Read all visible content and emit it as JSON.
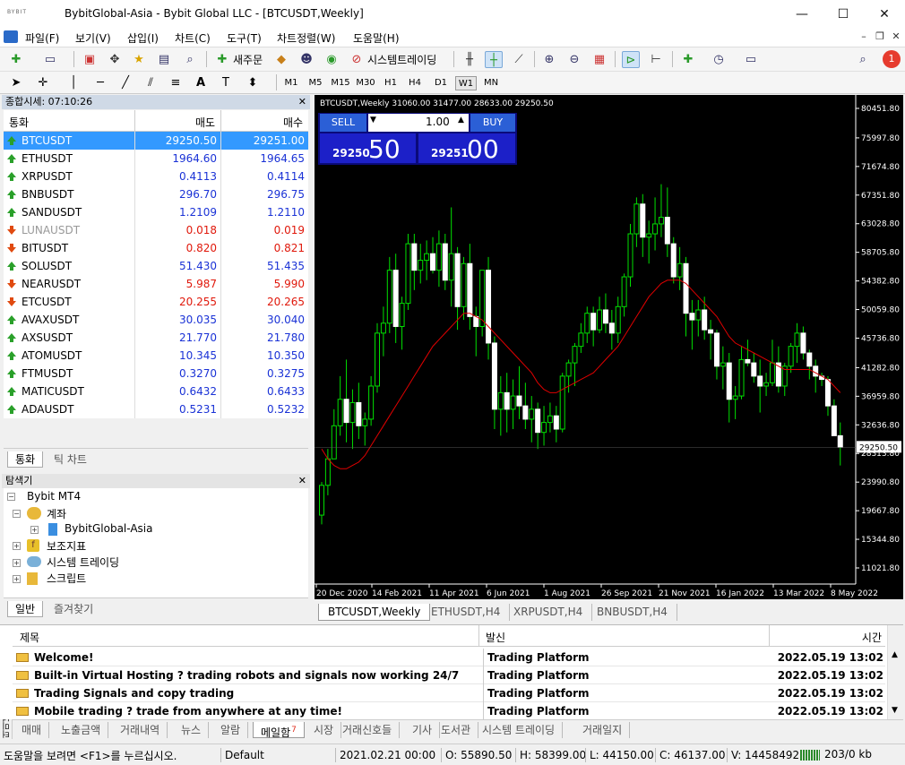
{
  "window": {
    "logo": "BYBIT",
    "title": "BybitGlobal-Asia - Bybit Global LLC - [BTCUSDT,Weekly]"
  },
  "menu": [
    "파일(F)",
    "보기(V)",
    "삽입(I)",
    "차트(C)",
    "도구(T)",
    "차트정렬(W)",
    "도움말(H)"
  ],
  "toolbar": {
    "new_order": "새주문",
    "algo_trading": "시스템트레이딩",
    "notify_count": "1"
  },
  "timeframes": [
    "M1",
    "M5",
    "M15",
    "M30",
    "H1",
    "H4",
    "D1",
    "W1",
    "MN"
  ],
  "active_timeframe": "W1",
  "market_watch": {
    "header": "종합시세: 07:10:26",
    "cols": {
      "symbol": "통화",
      "bid": "매도",
      "ask": "매수"
    },
    "rows": [
      {
        "symbol": "BTCUSDT",
        "bid": "29250.50",
        "ask": "29251.00",
        "dir": "up",
        "color": "sel"
      },
      {
        "symbol": "ETHUSDT",
        "bid": "1964.60",
        "ask": "1964.65",
        "dir": "up",
        "color": "blue"
      },
      {
        "symbol": "XRPUSDT",
        "bid": "0.4113",
        "ask": "0.4114",
        "dir": "up",
        "color": "blue"
      },
      {
        "symbol": "BNBUSDT",
        "bid": "296.70",
        "ask": "296.75",
        "dir": "up",
        "color": "blue"
      },
      {
        "symbol": "SANDUSDT",
        "bid": "1.2109",
        "ask": "1.2110",
        "dir": "up",
        "color": "blue"
      },
      {
        "symbol": "LUNAUSDT",
        "bid": "0.018",
        "ask": "0.019",
        "dir": "down",
        "color": "red",
        "gray": true
      },
      {
        "symbol": "BITUSDT",
        "bid": "0.820",
        "ask": "0.821",
        "dir": "down",
        "color": "red"
      },
      {
        "symbol": "SOLUSDT",
        "bid": "51.430",
        "ask": "51.435",
        "dir": "up",
        "color": "blue"
      },
      {
        "symbol": "NEARUSDT",
        "bid": "5.987",
        "ask": "5.990",
        "dir": "down",
        "color": "red"
      },
      {
        "symbol": "ETCUSDT",
        "bid": "20.255",
        "ask": "20.265",
        "dir": "down",
        "color": "red"
      },
      {
        "symbol": "AVAXUSDT",
        "bid": "30.035",
        "ask": "30.040",
        "dir": "up",
        "color": "blue"
      },
      {
        "symbol": "AXSUSDT",
        "bid": "21.770",
        "ask": "21.780",
        "dir": "up",
        "color": "blue"
      },
      {
        "symbol": "ATOMUSDT",
        "bid": "10.345",
        "ask": "10.350",
        "dir": "up",
        "color": "blue"
      },
      {
        "symbol": "FTMUSDT",
        "bid": "0.3270",
        "ask": "0.3275",
        "dir": "up",
        "color": "blue"
      },
      {
        "symbol": "MATICUSDT",
        "bid": "0.6432",
        "ask": "0.6433",
        "dir": "up",
        "color": "blue"
      },
      {
        "symbol": "ADAUSDT",
        "bid": "0.5231",
        "ask": "0.5232",
        "dir": "up",
        "color": "blue"
      }
    ],
    "tabs": [
      "통화",
      "틱 차트"
    ]
  },
  "navigator": {
    "header": "탐색기",
    "root": "Bybit MT4",
    "accounts": "계좌",
    "account": "BybitGlobal-Asia",
    "indicators": "보조지표",
    "experts": "시스템 트레이딩",
    "scripts": "스크립트",
    "tabs": [
      "일반",
      "즐겨찾기"
    ]
  },
  "chart": {
    "info": "BTCUSDT,Weekly  31060.00 31477.00 28633.00 29250.50",
    "sell_label": "SELL",
    "buy_label": "BUY",
    "lot": "1.00",
    "sell_big": "50",
    "sell_small": "29250",
    "buy_big": "00",
    "buy_small": "29251",
    "price_ticks": [
      "80451.80",
      "75997.80",
      "71674.80",
      "67351.80",
      "63028.80",
      "58705.80",
      "54382.80",
      "50059.80",
      "45736.80",
      "41282.80",
      "36959.80",
      "32636.80",
      "28313.80",
      "23990.80",
      "19667.80",
      "15344.80",
      "11021.80"
    ],
    "current_price": "29250.50",
    "date_ticks": [
      "20 Dec 2020",
      "14 Feb 2021",
      "11 Apr 2021",
      "6 Jun 2021",
      "1 Aug 2021",
      "26 Sep 2021",
      "21 Nov 2021",
      "16 Jan 2022",
      "13 Mar 2022",
      "8 May 2022"
    ],
    "tabs": [
      "BTCUSDT,Weekly",
      "ETHUSDT,H4",
      "XRPUSDT,H4",
      "BNBUSDT,H4"
    ]
  },
  "chart_data": {
    "type": "candlestick",
    "title": "BTCUSDT,Weekly",
    "ylim": [
      11021.8,
      82000
    ],
    "candles": [
      [
        19000,
        24000,
        17600,
        23500
      ],
      [
        23500,
        29000,
        22000,
        27500
      ],
      [
        27500,
        35000,
        28000,
        32500
      ],
      [
        32500,
        40000,
        31000,
        36500
      ],
      [
        36500,
        42500,
        30000,
        33000
      ],
      [
        33000,
        38000,
        29000,
        36000
      ],
      [
        36000,
        39000,
        30500,
        32500
      ],
      [
        32500,
        34500,
        29500,
        33500
      ],
      [
        33500,
        40000,
        32500,
        38500
      ],
      [
        38500,
        48000,
        37500,
        46500
      ],
      [
        46500,
        50500,
        43000,
        48000
      ],
      [
        48000,
        58000,
        46500,
        56000
      ],
      [
        56000,
        58500,
        45000,
        47500
      ],
      [
        47500,
        52000,
        44000,
        51000
      ],
      [
        51000,
        61500,
        50000,
        60000
      ],
      [
        60000,
        61500,
        53000,
        56000
      ],
      [
        56000,
        60000,
        54000,
        57500
      ],
      [
        57500,
        60500,
        54500,
        58500
      ],
      [
        58500,
        61000,
        55500,
        56000
      ],
      [
        56000,
        62000,
        53500,
        60000
      ],
      [
        60000,
        61500,
        53000,
        54500
      ],
      [
        54500,
        65500,
        50500,
        58500
      ],
      [
        58500,
        59500,
        47000,
        50500
      ],
      [
        50500,
        58000,
        48500,
        57000
      ],
      [
        57000,
        60000,
        47000,
        49000
      ],
      [
        49000,
        50500,
        43000,
        47500
      ],
      [
        47500,
        56000,
        46000,
        56000
      ],
      [
        56000,
        58000,
        42500,
        45000
      ],
      [
        45000,
        46000,
        32000,
        35000
      ],
      [
        35000,
        40000,
        31000,
        37500
      ],
      [
        37500,
        40500,
        31500,
        35000
      ],
      [
        35000,
        39500,
        32000,
        37000
      ],
      [
        37000,
        41500,
        33500,
        35500
      ],
      [
        35500,
        39000,
        32000,
        33500
      ],
      [
        33500,
        37000,
        30000,
        35000
      ],
      [
        35000,
        36000,
        29000,
        31500
      ],
      [
        31500,
        35500,
        29500,
        33000
      ],
      [
        33000,
        36000,
        31500,
        34000
      ],
      [
        34000,
        35500,
        30000,
        32000
      ],
      [
        32000,
        40500,
        31500,
        40000
      ],
      [
        40000,
        42500,
        37500,
        42000
      ],
      [
        42000,
        45000,
        38500,
        44500
      ],
      [
        44500,
        48000,
        43500,
        46500
      ],
      [
        46500,
        50500,
        45000,
        49500
      ],
      [
        49500,
        50500,
        44500,
        47000
      ],
      [
        47000,
        52000,
        46500,
        50000
      ],
      [
        50000,
        52500,
        46500,
        48000
      ],
      [
        48000,
        50000,
        44000,
        46500
      ],
      [
        46500,
        52000,
        45000,
        50500
      ],
      [
        50500,
        55500,
        49000,
        55000
      ],
      [
        55000,
        63000,
        53500,
        61500
      ],
      [
        61500,
        67000,
        59500,
        66000
      ],
      [
        66000,
        67500,
        58000,
        61000
      ],
      [
        61000,
        63500,
        57000,
        61500
      ],
      [
        61500,
        67000,
        59000,
        63000
      ],
      [
        63000,
        69000,
        61000,
        64000
      ],
      [
        64000,
        68500,
        58000,
        60000
      ],
      [
        60000,
        61000,
        54000,
        55000
      ],
      [
        55000,
        59500,
        53000,
        57000
      ],
      [
        57000,
        58000,
        46000,
        49500
      ],
      [
        49500,
        51500,
        44000,
        48500
      ],
      [
        48500,
        51500,
        46000,
        50000
      ],
      [
        50000,
        52000,
        45500,
        47000
      ],
      [
        47000,
        48500,
        42500,
        46500
      ],
      [
        46500,
        47000,
        39500,
        41500
      ],
      [
        41500,
        44500,
        38000,
        42000
      ],
      [
        42000,
        43500,
        33000,
        36500
      ],
      [
        36500,
        38500,
        33500,
        37000
      ],
      [
        37000,
        44500,
        36500,
        42500
      ],
      [
        42500,
        45500,
        41500,
        42000
      ],
      [
        42000,
        43500,
        39000,
        40000
      ],
      [
        40000,
        42500,
        34500,
        38500
      ],
      [
        38500,
        40500,
        37000,
        39000
      ],
      [
        39000,
        45500,
        38500,
        42000
      ],
      [
        42000,
        44500,
        37500,
        38500
      ],
      [
        38500,
        42000,
        37000,
        41500
      ],
      [
        41500,
        45000,
        40500,
        44500
      ],
      [
        44500,
        48000,
        42000,
        46500
      ],
      [
        46500,
        47500,
        42500,
        43500
      ],
      [
        43500,
        44000,
        39500,
        41500
      ],
      [
        41500,
        42500,
        37500,
        40000
      ],
      [
        40000,
        40500,
        38500,
        39500
      ],
      [
        39500,
        40000,
        34000,
        35500
      ],
      [
        35500,
        36500,
        31000,
        31000
      ],
      [
        31000,
        33000,
        26500,
        29250
      ]
    ],
    "ma": [
      29000,
      27500,
      26500,
      26000,
      26000,
      26500,
      27000,
      28000,
      29500,
      31000,
      32500,
      34000,
      35500,
      37000,
      38500,
      40000,
      41500,
      43000,
      44500,
      45500,
      46500,
      47500,
      48500,
      49500,
      49500,
      49000,
      48500,
      47500,
      46500,
      45500,
      44500,
      43500,
      42500,
      41500,
      40500,
      39000,
      38000,
      37500,
      37500,
      38000,
      38500,
      39000,
      39500,
      40000,
      40500,
      41500,
      42500,
      43500,
      44500,
      46000,
      47500,
      49000,
      50500,
      52000,
      53000,
      54000,
      54500,
      54500,
      54500,
      54000,
      53000,
      52000,
      51000,
      50000,
      49000,
      47500,
      46000,
      45000,
      44500,
      44000,
      43500,
      43000,
      42500,
      42000,
      41500,
      41000,
      41000,
      41000,
      41000,
      41000,
      40500,
      40000,
      39500,
      38500,
      37500
    ]
  },
  "terminal": {
    "cols": {
      "subject": "제목",
      "from": "발신",
      "time": "시간"
    },
    "rows": [
      {
        "subject": "Welcome!",
        "from": "Trading Platform",
        "time": "2022.05.19 13:02"
      },
      {
        "subject": "Built-in Virtual Hosting ? trading robots and signals now working 24/7",
        "from": "Trading Platform",
        "time": "2022.05.19 13:02"
      },
      {
        "subject": "Trading Signals and copy trading",
        "from": "Trading Platform",
        "time": "2022.05.19 13:02"
      },
      {
        "subject": "Mobile trading ? trade from anywhere at any time!",
        "from": "Trading Platform",
        "time": "2022.05.19 13:02"
      }
    ],
    "tabs": [
      "매매",
      "노출금액",
      "거래내역",
      "뉴스",
      "알람",
      "메일함",
      "시장",
      "거래신호들",
      "기사",
      "도서관",
      "시스템 트레이딩",
      "거래일지"
    ],
    "mail_badge": "7",
    "side_label": "터미널"
  },
  "status": {
    "help": "도움말을 보려면 <F1>를 누르십시오.",
    "profile": "Default",
    "datetime": "2021.02.21 00:00",
    "open": "O: 55890.50",
    "high": "H: 58399.00",
    "low": "L: 44150.00",
    "close": "C: 46137.00",
    "volume": "V: 14458492",
    "traffic": "203/0 kb"
  }
}
